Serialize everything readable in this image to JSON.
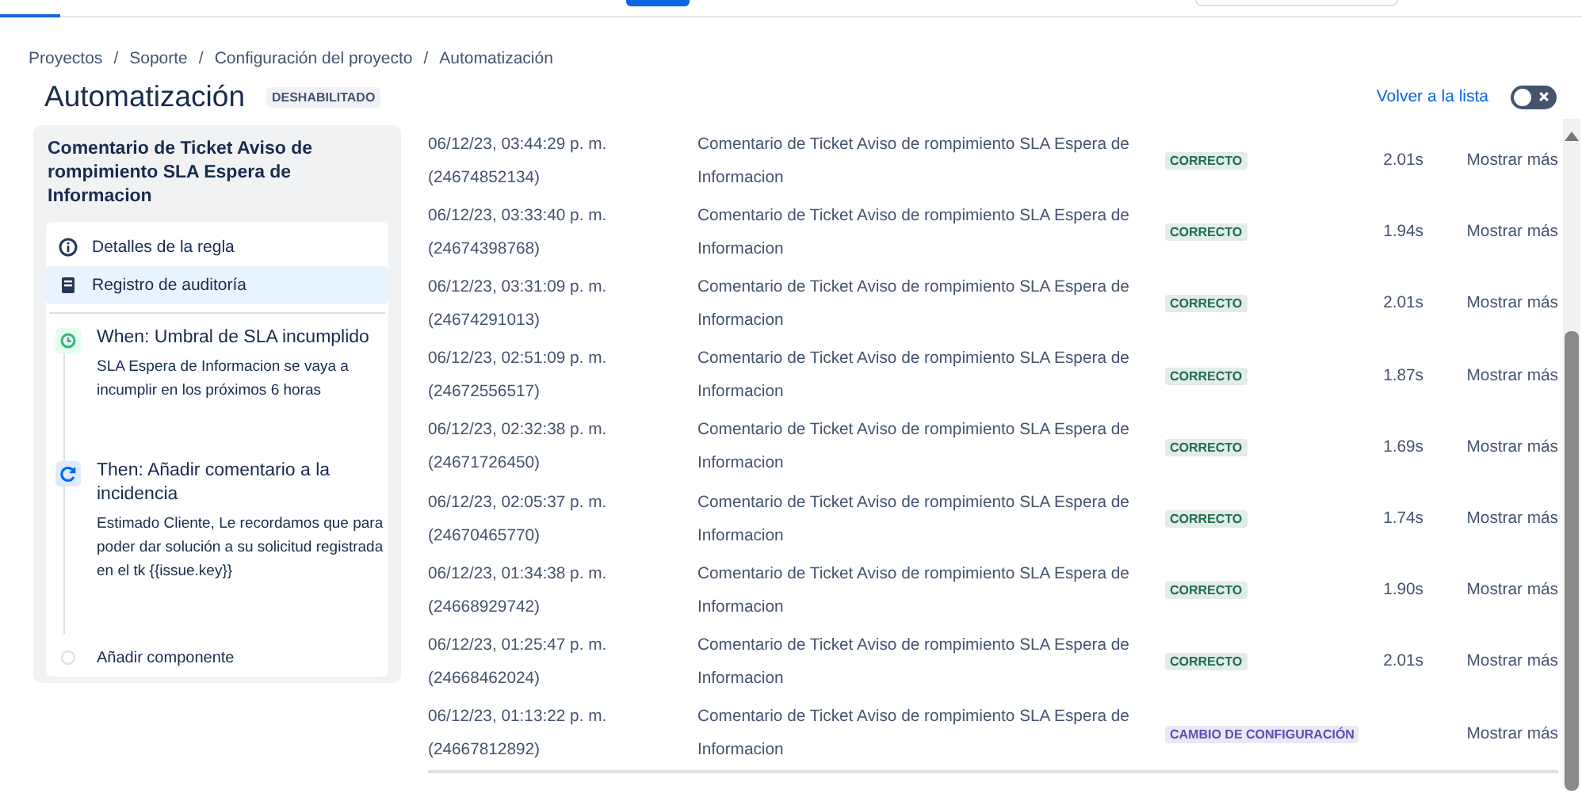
{
  "breadcrumbs": [
    {
      "label": "Proyectos"
    },
    {
      "separator": "/",
      "label": "Soporte"
    },
    {
      "separator": "/",
      "label": "Configuración del proyecto"
    },
    {
      "separator": "/",
      "label": "Automatización"
    }
  ],
  "page": {
    "title": "Automatización",
    "status_badge": "DESHABILITADO",
    "back_link": "Volver a la lista",
    "toggle": {
      "on": false
    }
  },
  "rule": {
    "title": "Comentario de Ticket Aviso de rompimiento SLA Espera de Informacion",
    "nav": [
      {
        "label": "Detalles de la regla",
        "selected": false
      },
      {
        "label": "Registro de auditoría",
        "selected": true
      }
    ],
    "steps": [
      {
        "kind": "when",
        "title": "When: Umbral de SLA incumplido",
        "description": "SLA Espera de Informacion se vaya a incumplir en los próximos 6 horas"
      },
      {
        "kind": "then",
        "title": "Then: Añadir comentario a la incidencia",
        "description": "Estimado Cliente, Le recordamos que para poder dar solución a su solicitud registrada en el tk {{issue.key}}"
      },
      {
        "kind": "add",
        "title": "Añadir componente"
      }
    ]
  },
  "audit_rows": [
    {
      "date": "06/12/23, 03:44:29 p. m.",
      "id": "(24674852134)",
      "rule": "Comentario de Ticket Aviso de rompimiento SLA Espera de Informacion",
      "status": "CORRECTO",
      "color": "#216e4e",
      "duration": "2.01s",
      "action": "Mostrar más"
    },
    {
      "date": "06/12/23, 03:33:40 p. m.",
      "id": "(24674398768)",
      "rule": "Comentario de Ticket Aviso de rompimiento SLA Espera de Informacion",
      "status": "CORRECTO",
      "color": "#216e4e",
      "duration": "1.94s",
      "action": "Mostrar más"
    },
    {
      "date": "06/12/23, 03:31:09 p. m.",
      "id": "(24674291013)",
      "rule": "Comentario de Ticket Aviso de rompimiento SLA Espera de Informacion",
      "status": "CORRECTO",
      "color": "#216e4e",
      "duration": "2.01s",
      "action": "Mostrar más"
    },
    {
      "date": "06/12/23, 02:51:09 p. m.",
      "id": "(24672556517)",
      "rule": "Comentario de Ticket Aviso de rompimiento SLA Espera de Informacion",
      "status": "CORRECTO",
      "color": "#216e4e",
      "duration": "1.87s",
      "action": "Mostrar más"
    },
    {
      "date": "06/12/23, 02:32:38 p. m.",
      "id": "(24671726450)",
      "rule": "Comentario de Ticket Aviso de rompimiento SLA Espera de Informacion",
      "status": "CORRECTO",
      "color": "#216e4e",
      "duration": "1.69s",
      "action": "Mostrar más"
    },
    {
      "date": "06/12/23, 02:05:37 p. m.",
      "id": "(24670465770)",
      "rule": "Comentario de Ticket Aviso de rompimiento SLA Espera de Informacion",
      "status": "CORRECTO",
      "color": "#216e4e",
      "duration": "1.74s",
      "action": "Mostrar más"
    },
    {
      "date": "06/12/23, 01:34:38 p. m.",
      "id": "(24668929742)",
      "rule": "Comentario de Ticket Aviso de rompimiento SLA Espera de Informacion",
      "status": "CORRECTO",
      "color": "#216e4e",
      "duration": "1.90s",
      "action": "Mostrar más"
    },
    {
      "date": "06/12/23, 01:25:47 p. m.",
      "id": "(24668462024)",
      "rule": "Comentario de Ticket Aviso de rompimiento SLA Espera de Informacion",
      "status": "CORRECTO",
      "color": "#216e4e",
      "duration": "2.01s",
      "action": "Mostrar más"
    },
    {
      "date": "06/12/23, 01:13:22 p. m.",
      "id": "(24667812892)",
      "rule": "Comentario de Ticket Aviso de rompimiento SLA Espera de Informacion",
      "status": "CAMBIO DE CONFIGURACIÓN",
      "color": "#5e4db2",
      "action": "Mostrar más"
    }
  ]
}
